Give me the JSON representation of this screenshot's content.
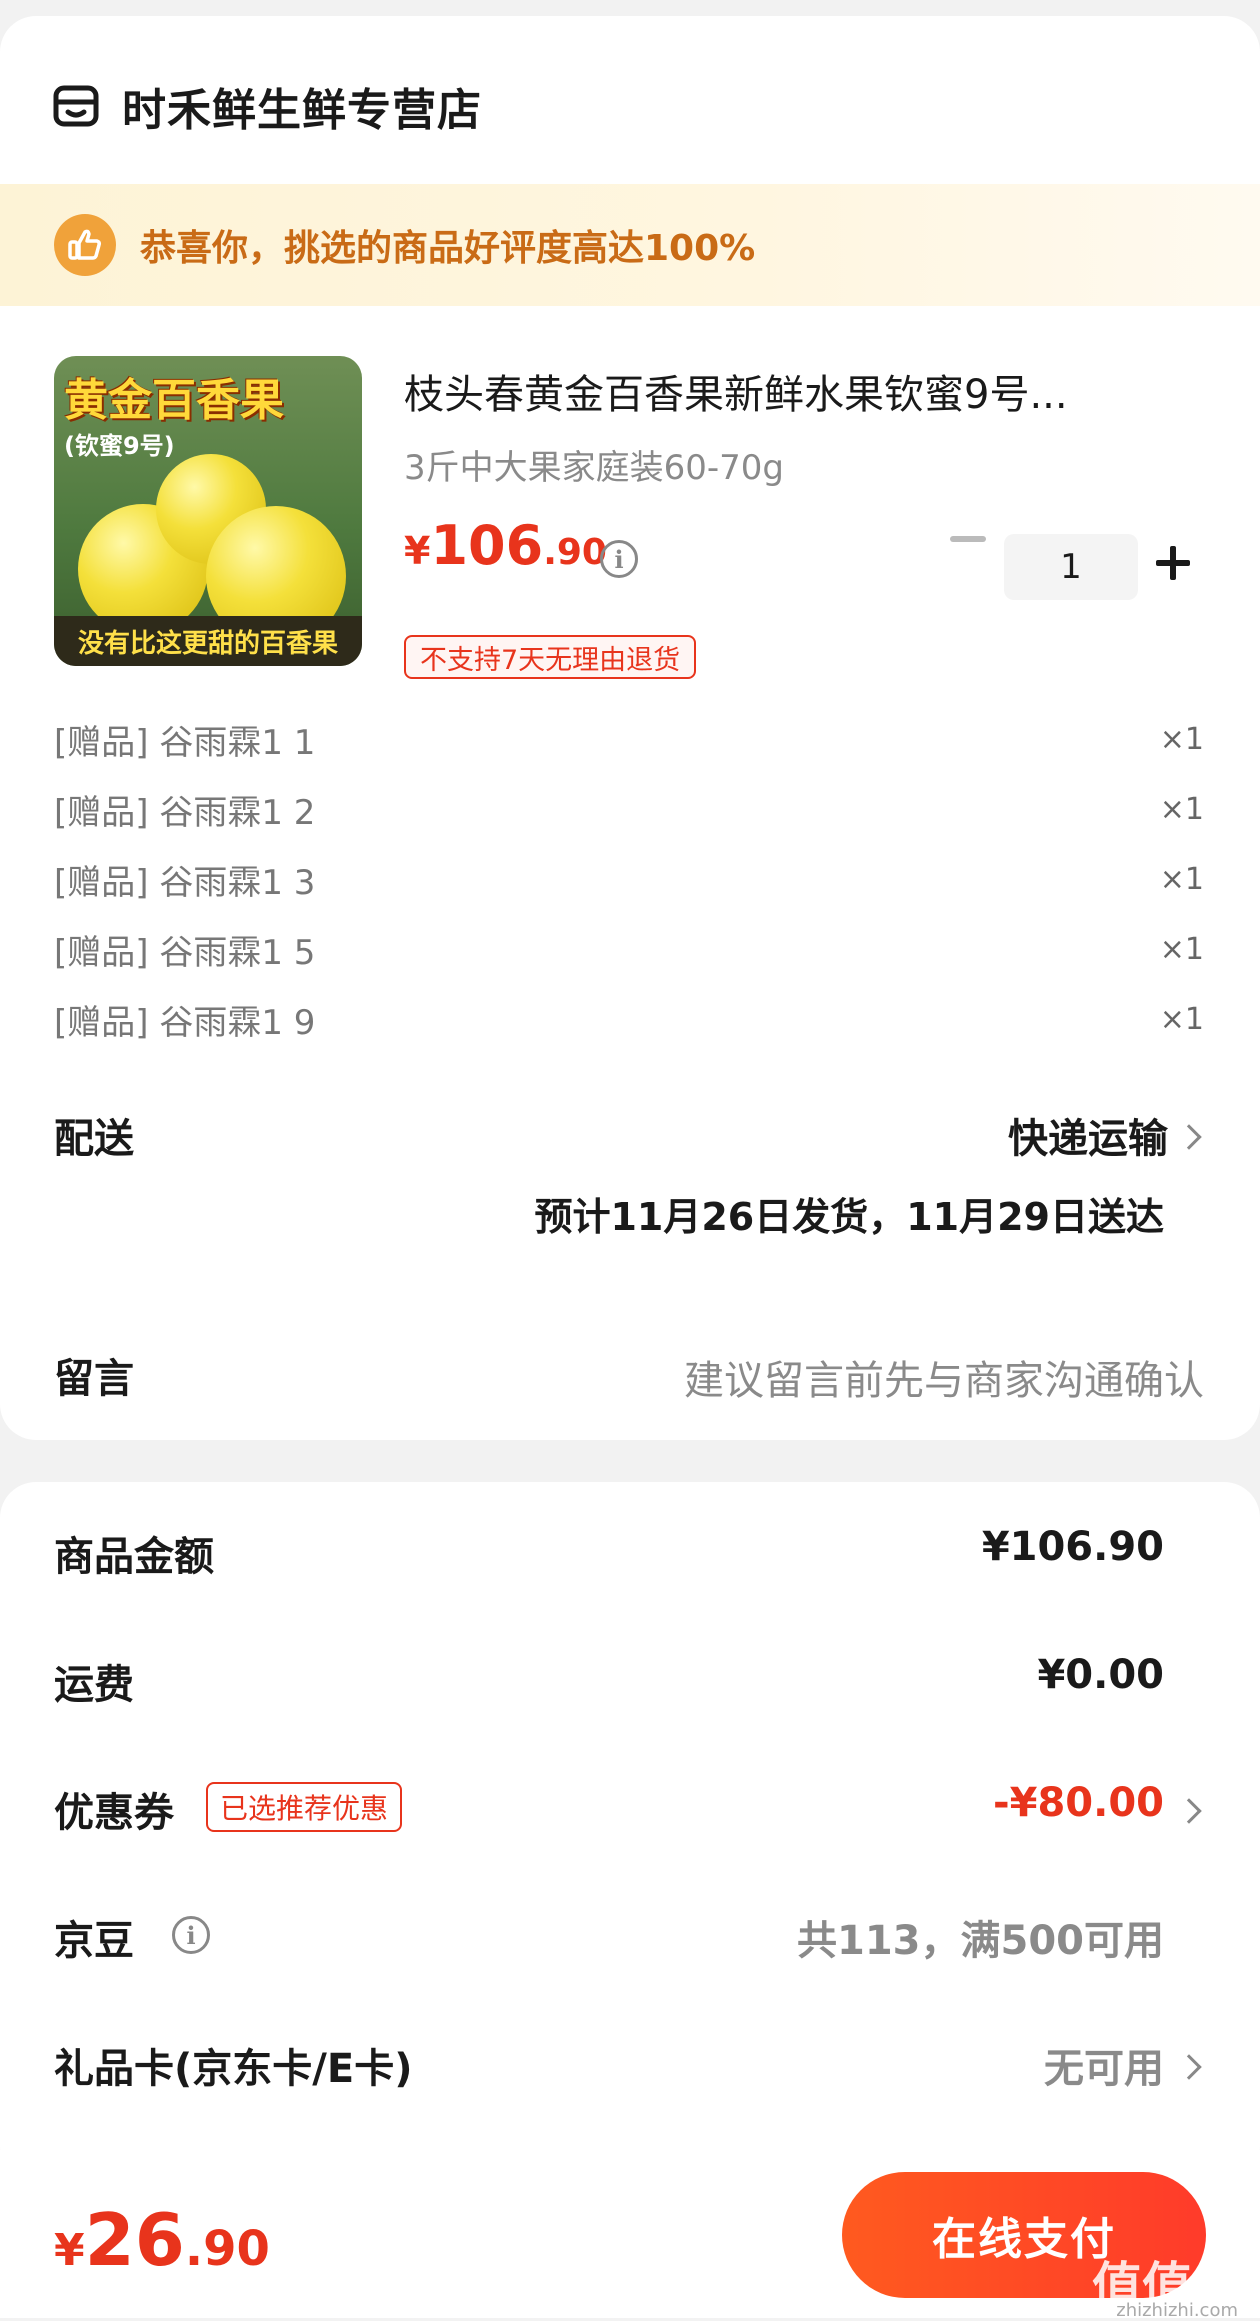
{
  "shop": {
    "name": "时禾鲜生鲜专营店"
  },
  "banner": {
    "text": "恭喜你，挑选的商品好评度高达100%"
  },
  "product": {
    "image_title": "黄金百香果",
    "image_subtitle": "(钦蜜9号)",
    "image_bottom": "没有比这更甜的百香果",
    "title": "枝头春黄金百香果新鲜水果钦蜜9号...",
    "spec": "3斤中大果家庭装60-70g",
    "price_currency": "¥",
    "price_int": "106",
    "price_dec": ".90",
    "quantity": "1",
    "tag": "不支持7天无理由退货"
  },
  "gifts": [
    {
      "label": "[赠品] 谷雨霖1 1",
      "qty": "×1"
    },
    {
      "label": "[赠品] 谷雨霖1 2",
      "qty": "×1"
    },
    {
      "label": "[赠品] 谷雨霖1 3",
      "qty": "×1"
    },
    {
      "label": "[赠品] 谷雨霖1 5",
      "qty": "×1"
    },
    {
      "label": "[赠品] 谷雨霖1 9",
      "qty": "×1"
    }
  ],
  "delivery": {
    "label": "配送",
    "method": "快递运输",
    "estimate": "预计11月26日发货，11月29日送达"
  },
  "message": {
    "label": "留言",
    "placeholder": "建议留言前先与商家沟通确认"
  },
  "summary": {
    "goods_label": "商品金额",
    "goods_value": "¥106.90",
    "shipping_label": "运费",
    "shipping_value": "¥0.00",
    "coupon_label": "优惠券",
    "coupon_tag": "已选推荐优惠",
    "coupon_value": "-¥80.00",
    "jingdou_label": "京豆",
    "jingdou_value": "共113，满500可用",
    "giftcard_label": "礼品卡(京东卡/E卡)",
    "giftcard_value": "无可用"
  },
  "bottom": {
    "total_currency": "¥",
    "total_int": "26",
    "total_dec": ".90",
    "pay_label": "在线支付",
    "watermark": "值值值",
    "watermark_sub": "zhizhizhi.com"
  },
  "colors": {
    "accent": "#e8341c",
    "banner_text": "#c96b16",
    "pay_button": "#ff4a24"
  }
}
